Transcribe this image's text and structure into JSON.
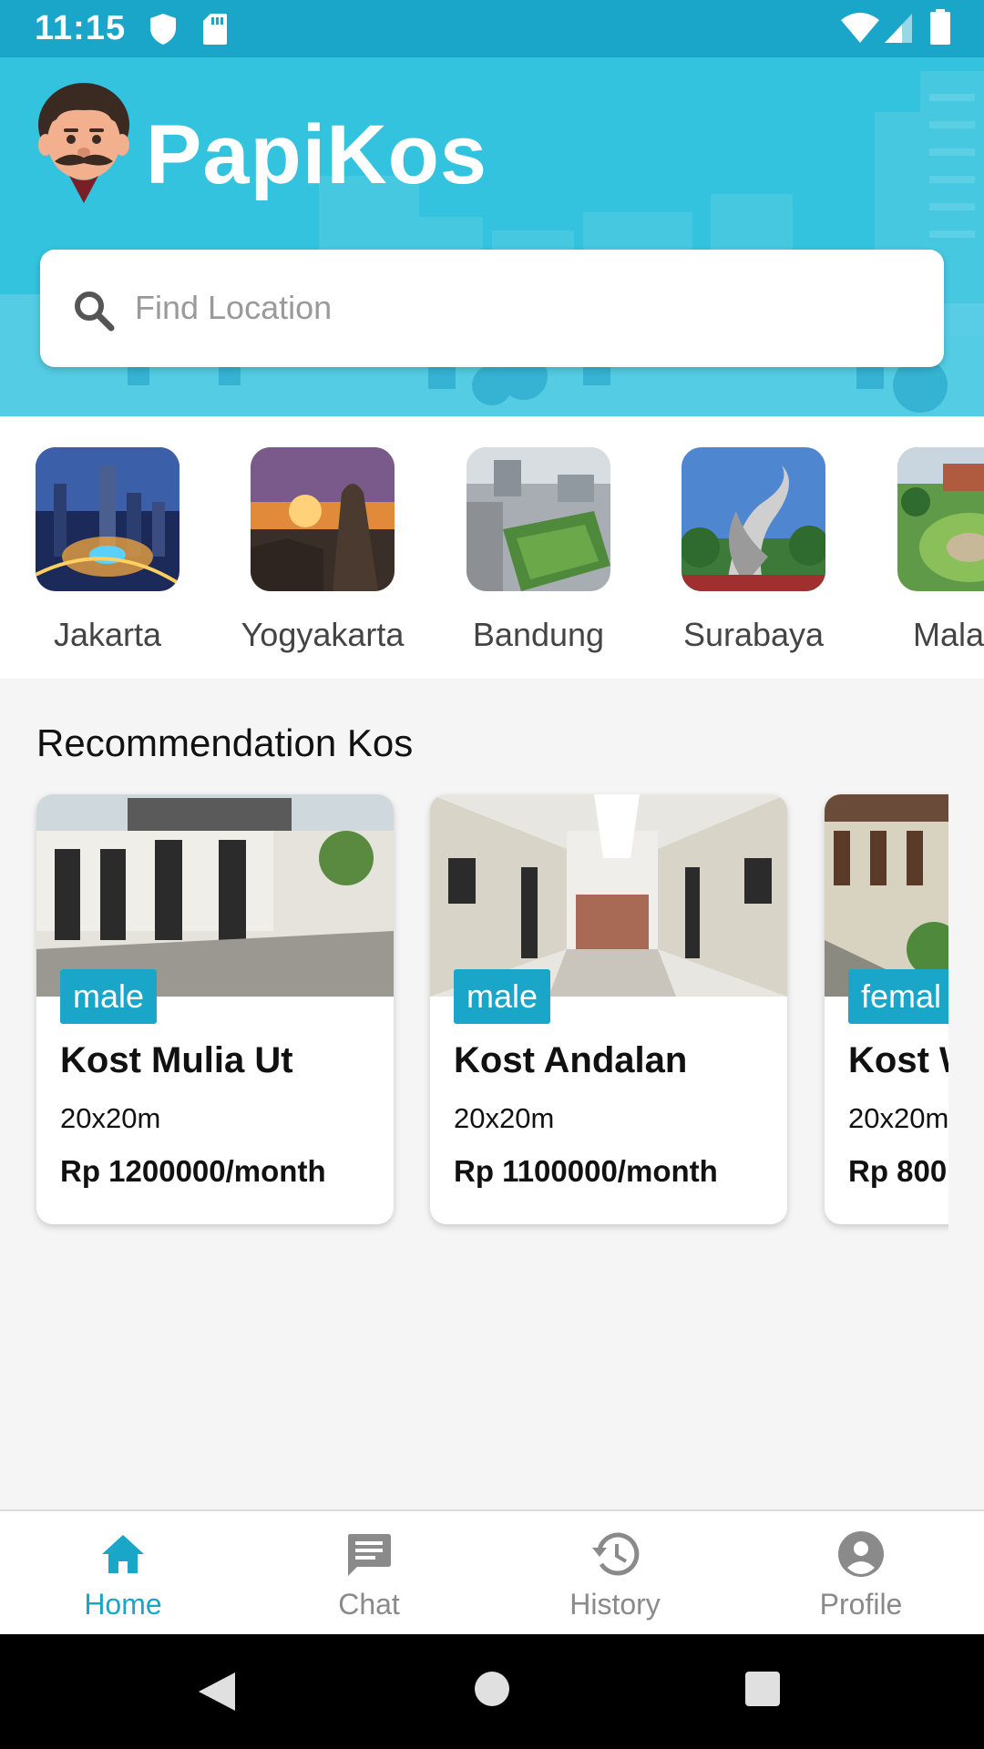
{
  "status_bar": {
    "time": "11:15",
    "icons": [
      "shield-icon",
      "sd-card-icon",
      "wifi-icon",
      "signal-icon",
      "battery-icon"
    ]
  },
  "header": {
    "app_name": "PapiKos",
    "search_placeholder": "Find Location",
    "search_value": "",
    "background_color": "#33c3de"
  },
  "cities": [
    {
      "name": "Jakarta"
    },
    {
      "name": "Yogyakarta"
    },
    {
      "name": "Bandung"
    },
    {
      "name": "Surabaya"
    },
    {
      "name": "Mala"
    }
  ],
  "recommendation": {
    "title": "Recommendation Kos",
    "items": [
      {
        "gender": "male",
        "name": "Kost Mulia Ut",
        "size": "20x20m",
        "price": "Rp 1200000/month"
      },
      {
        "gender": "male",
        "name": "Kost Andalan",
        "size": "20x20m",
        "price": "Rp 1100000/month"
      },
      {
        "gender": "femal",
        "name": "Kost W",
        "size": "20x20m",
        "price": "Rp 800"
      }
    ]
  },
  "bottom_nav": {
    "items": [
      {
        "label": "Home",
        "icon": "home-icon",
        "active": true
      },
      {
        "label": "Chat",
        "icon": "chat-icon",
        "active": false
      },
      {
        "label": "History",
        "icon": "history-icon",
        "active": false
      },
      {
        "label": "Profile",
        "icon": "profile-icon",
        "active": false
      }
    ]
  },
  "colors": {
    "accent": "#1aa6c9",
    "header": "#33c3de",
    "background": "#f5f5f5"
  }
}
